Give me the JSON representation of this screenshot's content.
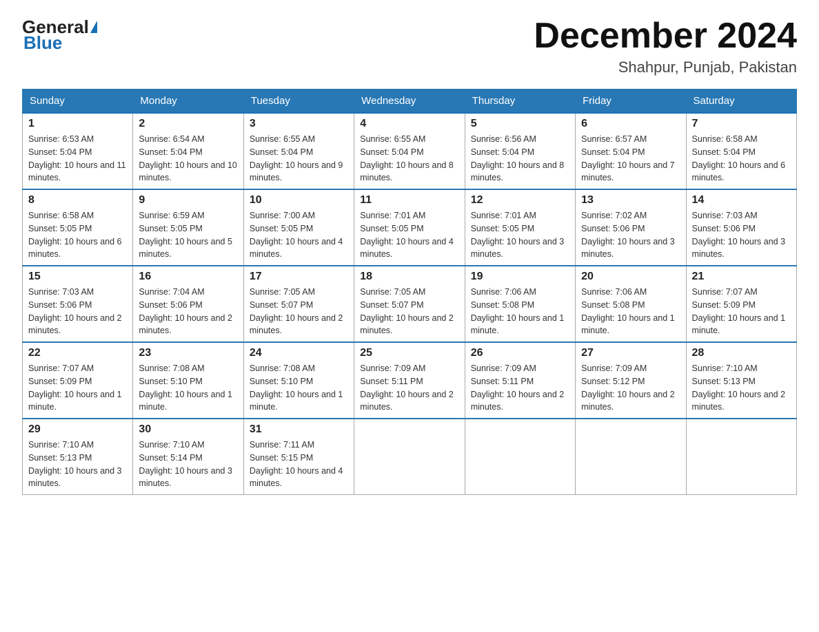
{
  "header": {
    "logo_general": "General",
    "logo_blue": "Blue",
    "month_title": "December 2024",
    "location": "Shahpur, Punjab, Pakistan"
  },
  "days_of_week": [
    "Sunday",
    "Monday",
    "Tuesday",
    "Wednesday",
    "Thursday",
    "Friday",
    "Saturday"
  ],
  "weeks": [
    [
      {
        "day": "1",
        "sunrise": "6:53 AM",
        "sunset": "5:04 PM",
        "daylight": "10 hours and 11 minutes."
      },
      {
        "day": "2",
        "sunrise": "6:54 AM",
        "sunset": "5:04 PM",
        "daylight": "10 hours and 10 minutes."
      },
      {
        "day": "3",
        "sunrise": "6:55 AM",
        "sunset": "5:04 PM",
        "daylight": "10 hours and 9 minutes."
      },
      {
        "day": "4",
        "sunrise": "6:55 AM",
        "sunset": "5:04 PM",
        "daylight": "10 hours and 8 minutes."
      },
      {
        "day": "5",
        "sunrise": "6:56 AM",
        "sunset": "5:04 PM",
        "daylight": "10 hours and 8 minutes."
      },
      {
        "day": "6",
        "sunrise": "6:57 AM",
        "sunset": "5:04 PM",
        "daylight": "10 hours and 7 minutes."
      },
      {
        "day": "7",
        "sunrise": "6:58 AM",
        "sunset": "5:04 PM",
        "daylight": "10 hours and 6 minutes."
      }
    ],
    [
      {
        "day": "8",
        "sunrise": "6:58 AM",
        "sunset": "5:05 PM",
        "daylight": "10 hours and 6 minutes."
      },
      {
        "day": "9",
        "sunrise": "6:59 AM",
        "sunset": "5:05 PM",
        "daylight": "10 hours and 5 minutes."
      },
      {
        "day": "10",
        "sunrise": "7:00 AM",
        "sunset": "5:05 PM",
        "daylight": "10 hours and 4 minutes."
      },
      {
        "day": "11",
        "sunrise": "7:01 AM",
        "sunset": "5:05 PM",
        "daylight": "10 hours and 4 minutes."
      },
      {
        "day": "12",
        "sunrise": "7:01 AM",
        "sunset": "5:05 PM",
        "daylight": "10 hours and 3 minutes."
      },
      {
        "day": "13",
        "sunrise": "7:02 AM",
        "sunset": "5:06 PM",
        "daylight": "10 hours and 3 minutes."
      },
      {
        "day": "14",
        "sunrise": "7:03 AM",
        "sunset": "5:06 PM",
        "daylight": "10 hours and 3 minutes."
      }
    ],
    [
      {
        "day": "15",
        "sunrise": "7:03 AM",
        "sunset": "5:06 PM",
        "daylight": "10 hours and 2 minutes."
      },
      {
        "day": "16",
        "sunrise": "7:04 AM",
        "sunset": "5:06 PM",
        "daylight": "10 hours and 2 minutes."
      },
      {
        "day": "17",
        "sunrise": "7:05 AM",
        "sunset": "5:07 PM",
        "daylight": "10 hours and 2 minutes."
      },
      {
        "day": "18",
        "sunrise": "7:05 AM",
        "sunset": "5:07 PM",
        "daylight": "10 hours and 2 minutes."
      },
      {
        "day": "19",
        "sunrise": "7:06 AM",
        "sunset": "5:08 PM",
        "daylight": "10 hours and 1 minute."
      },
      {
        "day": "20",
        "sunrise": "7:06 AM",
        "sunset": "5:08 PM",
        "daylight": "10 hours and 1 minute."
      },
      {
        "day": "21",
        "sunrise": "7:07 AM",
        "sunset": "5:09 PM",
        "daylight": "10 hours and 1 minute."
      }
    ],
    [
      {
        "day": "22",
        "sunrise": "7:07 AM",
        "sunset": "5:09 PM",
        "daylight": "10 hours and 1 minute."
      },
      {
        "day": "23",
        "sunrise": "7:08 AM",
        "sunset": "5:10 PM",
        "daylight": "10 hours and 1 minute."
      },
      {
        "day": "24",
        "sunrise": "7:08 AM",
        "sunset": "5:10 PM",
        "daylight": "10 hours and 1 minute."
      },
      {
        "day": "25",
        "sunrise": "7:09 AM",
        "sunset": "5:11 PM",
        "daylight": "10 hours and 2 minutes."
      },
      {
        "day": "26",
        "sunrise": "7:09 AM",
        "sunset": "5:11 PM",
        "daylight": "10 hours and 2 minutes."
      },
      {
        "day": "27",
        "sunrise": "7:09 AM",
        "sunset": "5:12 PM",
        "daylight": "10 hours and 2 minutes."
      },
      {
        "day": "28",
        "sunrise": "7:10 AM",
        "sunset": "5:13 PM",
        "daylight": "10 hours and 2 minutes."
      }
    ],
    [
      {
        "day": "29",
        "sunrise": "7:10 AM",
        "sunset": "5:13 PM",
        "daylight": "10 hours and 3 minutes."
      },
      {
        "day": "30",
        "sunrise": "7:10 AM",
        "sunset": "5:14 PM",
        "daylight": "10 hours and 3 minutes."
      },
      {
        "day": "31",
        "sunrise": "7:11 AM",
        "sunset": "5:15 PM",
        "daylight": "10 hours and 4 minutes."
      },
      null,
      null,
      null,
      null
    ]
  ],
  "labels": {
    "sunrise_prefix": "Sunrise: ",
    "sunset_prefix": "Sunset: ",
    "daylight_prefix": "Daylight: "
  }
}
